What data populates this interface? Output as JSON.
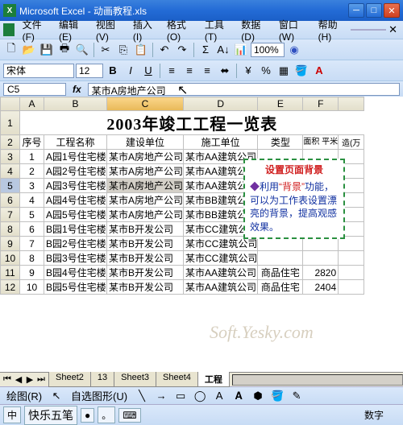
{
  "titlebar": {
    "app": "Microsoft Excel",
    "doc": "动画教程.xls"
  },
  "menu": [
    "文件(F)",
    "编辑(E)",
    "视图(V)",
    "插入(I)",
    "格式(O)",
    "工具(T)",
    "数据(D)",
    "窗口(W)",
    "帮助(H)"
  ],
  "toolbar": {
    "zoom": "100%",
    "fontname": "宋体",
    "fontsize": "12"
  },
  "formula_bar": {
    "cell_ref": "C5",
    "fx": "fx",
    "value": "某市A房地产公司"
  },
  "columns": [
    "A",
    "B",
    "C",
    "D",
    "E",
    "F"
  ],
  "title_row": "2003年竣工工程一览表",
  "headers": {
    "A": "序号",
    "B": "工程名称",
    "C": "建设单位",
    "D": "施工单位",
    "E": "类型",
    "F": "面积\n平米",
    "G": "造(万"
  },
  "rows": [
    {
      "n": "3",
      "A": "1",
      "B": "A园1号住宅楼",
      "C": "某市A房地产公司",
      "D": "某市AA建筑公司",
      "E": "",
      "F": ""
    },
    {
      "n": "4",
      "A": "2",
      "B": "A园2号住宅楼",
      "C": "某市A房地产公司",
      "D": "某市AA建筑公司",
      "E": "",
      "F": ""
    },
    {
      "n": "5",
      "A": "3",
      "B": "A园3号住宅楼",
      "C": "某市A房地产公司",
      "D": "某市AA建筑公司",
      "E": "",
      "F": ""
    },
    {
      "n": "6",
      "A": "4",
      "B": "A园4号住宅楼",
      "C": "某市A房地产公司",
      "D": "某市BB建筑公司",
      "E": "",
      "F": ""
    },
    {
      "n": "7",
      "A": "5",
      "B": "A园5号住宅楼",
      "C": "某市A房地产公司",
      "D": "某市BB建筑公司",
      "E": "",
      "F": ""
    },
    {
      "n": "8",
      "A": "6",
      "B": "B园1号住宅楼",
      "C": "某市B开发公司",
      "D": "某市CC建筑公司",
      "E": "",
      "F": ""
    },
    {
      "n": "9",
      "A": "7",
      "B": "B园2号住宅楼",
      "C": "某市B开发公司",
      "D": "某市CC建筑公司",
      "E": "",
      "F": ""
    },
    {
      "n": "10",
      "A": "8",
      "B": "B园3号住宅楼",
      "C": "某市B开发公司",
      "D": "某市CC建筑公司",
      "E": "",
      "F": ""
    },
    {
      "n": "11",
      "A": "9",
      "B": "B园4号住宅楼",
      "C": "某市B开发公司",
      "D": "某市AA建筑公司",
      "E": "商品住宅",
      "F": "2820"
    },
    {
      "n": "12",
      "A": "10",
      "B": "B园5号住宅楼",
      "C": "某市B开发公司",
      "D": "某市AA建筑公司",
      "E": "商品住宅",
      "F": "2404"
    }
  ],
  "callout": {
    "header": "设置页面背景",
    "body_pre": "利用",
    "body_q": "“背景”",
    "body_post": "功能，可以为工作表设置漂亮的背景，提高观感效果。"
  },
  "watermark": "Soft.Yesky.com",
  "tabs": {
    "items": [
      "Sheet2",
      "13",
      "Sheet3",
      "Sheet4",
      "工程"
    ],
    "active": 4
  },
  "drawbar": {
    "label": "绘图(R)",
    "autoshapes": "自选图形(U)"
  },
  "ime": {
    "label": "快乐五笔"
  },
  "statusbar": {
    "text": "数字"
  }
}
